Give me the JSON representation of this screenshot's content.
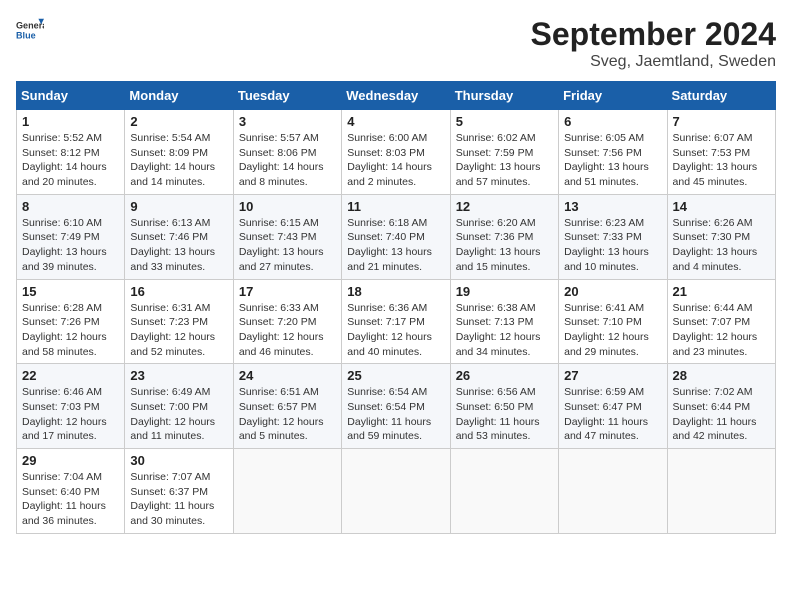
{
  "header": {
    "logo_general": "General",
    "logo_blue": "Blue",
    "month_title": "September 2024",
    "location": "Sveg, Jaemtland, Sweden"
  },
  "columns": [
    "Sunday",
    "Monday",
    "Tuesday",
    "Wednesday",
    "Thursday",
    "Friday",
    "Saturday"
  ],
  "weeks": [
    [
      {
        "day": "1",
        "info": "Sunrise: 5:52 AM\nSunset: 8:12 PM\nDaylight: 14 hours\nand 20 minutes."
      },
      {
        "day": "2",
        "info": "Sunrise: 5:54 AM\nSunset: 8:09 PM\nDaylight: 14 hours\nand 14 minutes."
      },
      {
        "day": "3",
        "info": "Sunrise: 5:57 AM\nSunset: 8:06 PM\nDaylight: 14 hours\nand 8 minutes."
      },
      {
        "day": "4",
        "info": "Sunrise: 6:00 AM\nSunset: 8:03 PM\nDaylight: 14 hours\nand 2 minutes."
      },
      {
        "day": "5",
        "info": "Sunrise: 6:02 AM\nSunset: 7:59 PM\nDaylight: 13 hours\nand 57 minutes."
      },
      {
        "day": "6",
        "info": "Sunrise: 6:05 AM\nSunset: 7:56 PM\nDaylight: 13 hours\nand 51 minutes."
      },
      {
        "day": "7",
        "info": "Sunrise: 6:07 AM\nSunset: 7:53 PM\nDaylight: 13 hours\nand 45 minutes."
      }
    ],
    [
      {
        "day": "8",
        "info": "Sunrise: 6:10 AM\nSunset: 7:49 PM\nDaylight: 13 hours\nand 39 minutes."
      },
      {
        "day": "9",
        "info": "Sunrise: 6:13 AM\nSunset: 7:46 PM\nDaylight: 13 hours\nand 33 minutes."
      },
      {
        "day": "10",
        "info": "Sunrise: 6:15 AM\nSunset: 7:43 PM\nDaylight: 13 hours\nand 27 minutes."
      },
      {
        "day": "11",
        "info": "Sunrise: 6:18 AM\nSunset: 7:40 PM\nDaylight: 13 hours\nand 21 minutes."
      },
      {
        "day": "12",
        "info": "Sunrise: 6:20 AM\nSunset: 7:36 PM\nDaylight: 13 hours\nand 15 minutes."
      },
      {
        "day": "13",
        "info": "Sunrise: 6:23 AM\nSunset: 7:33 PM\nDaylight: 13 hours\nand 10 minutes."
      },
      {
        "day": "14",
        "info": "Sunrise: 6:26 AM\nSunset: 7:30 PM\nDaylight: 13 hours\nand 4 minutes."
      }
    ],
    [
      {
        "day": "15",
        "info": "Sunrise: 6:28 AM\nSunset: 7:26 PM\nDaylight: 12 hours\nand 58 minutes."
      },
      {
        "day": "16",
        "info": "Sunrise: 6:31 AM\nSunset: 7:23 PM\nDaylight: 12 hours\nand 52 minutes."
      },
      {
        "day": "17",
        "info": "Sunrise: 6:33 AM\nSunset: 7:20 PM\nDaylight: 12 hours\nand 46 minutes."
      },
      {
        "day": "18",
        "info": "Sunrise: 6:36 AM\nSunset: 7:17 PM\nDaylight: 12 hours\nand 40 minutes."
      },
      {
        "day": "19",
        "info": "Sunrise: 6:38 AM\nSunset: 7:13 PM\nDaylight: 12 hours\nand 34 minutes."
      },
      {
        "day": "20",
        "info": "Sunrise: 6:41 AM\nSunset: 7:10 PM\nDaylight: 12 hours\nand 29 minutes."
      },
      {
        "day": "21",
        "info": "Sunrise: 6:44 AM\nSunset: 7:07 PM\nDaylight: 12 hours\nand 23 minutes."
      }
    ],
    [
      {
        "day": "22",
        "info": "Sunrise: 6:46 AM\nSunset: 7:03 PM\nDaylight: 12 hours\nand 17 minutes."
      },
      {
        "day": "23",
        "info": "Sunrise: 6:49 AM\nSunset: 7:00 PM\nDaylight: 12 hours\nand 11 minutes."
      },
      {
        "day": "24",
        "info": "Sunrise: 6:51 AM\nSunset: 6:57 PM\nDaylight: 12 hours\nand 5 minutes."
      },
      {
        "day": "25",
        "info": "Sunrise: 6:54 AM\nSunset: 6:54 PM\nDaylight: 11 hours\nand 59 minutes."
      },
      {
        "day": "26",
        "info": "Sunrise: 6:56 AM\nSunset: 6:50 PM\nDaylight: 11 hours\nand 53 minutes."
      },
      {
        "day": "27",
        "info": "Sunrise: 6:59 AM\nSunset: 6:47 PM\nDaylight: 11 hours\nand 47 minutes."
      },
      {
        "day": "28",
        "info": "Sunrise: 7:02 AM\nSunset: 6:44 PM\nDaylight: 11 hours\nand 42 minutes."
      }
    ],
    [
      {
        "day": "29",
        "info": "Sunrise: 7:04 AM\nSunset: 6:40 PM\nDaylight: 11 hours\nand 36 minutes."
      },
      {
        "day": "30",
        "info": "Sunrise: 7:07 AM\nSunset: 6:37 PM\nDaylight: 11 hours\nand 30 minutes."
      },
      {
        "day": "",
        "info": ""
      },
      {
        "day": "",
        "info": ""
      },
      {
        "day": "",
        "info": ""
      },
      {
        "day": "",
        "info": ""
      },
      {
        "day": "",
        "info": ""
      }
    ]
  ]
}
